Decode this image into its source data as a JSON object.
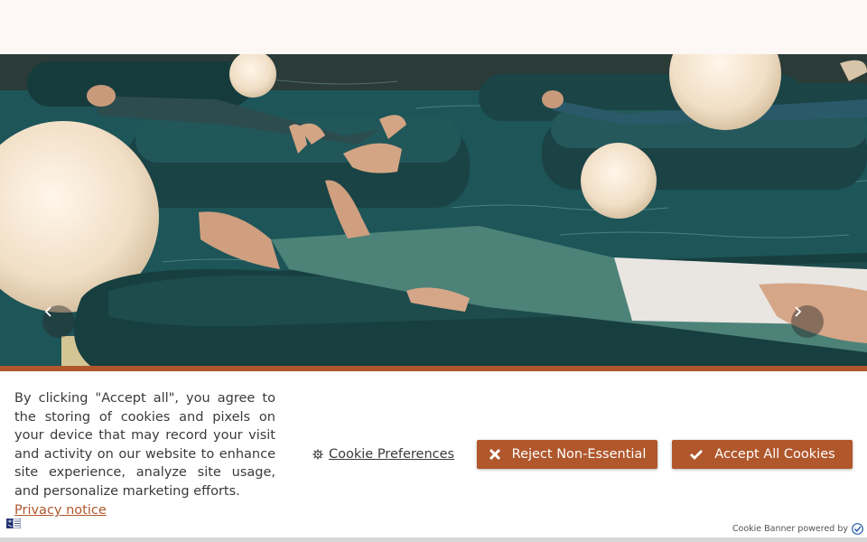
{
  "hero": {
    "prev_label": "Previous slide",
    "next_label": "Next slide"
  },
  "cookie_banner": {
    "message": "By clicking \"Accept all\", you agree to the storing of cookies and pixels on your device that may record your visit and activity on our website to enhance site experience, analyze site usage, and personalize marketing efforts.",
    "privacy_link": "Privacy notice",
    "preferences_label": "Cookie Preferences",
    "reject_label": "Reject Non-Essential",
    "accept_label": "Accept All Cookies",
    "powered_by": "Cookie Banner powered by"
  },
  "colors": {
    "accent": "#b0572c",
    "banner_bg": "#ffffff",
    "page_bg": "#fdf8f5"
  },
  "icons": [
    "chevron-left-icon",
    "chevron-right-icon",
    "gear-icon",
    "close-icon",
    "check-icon",
    "language-icon",
    "shield-check-icon"
  ]
}
